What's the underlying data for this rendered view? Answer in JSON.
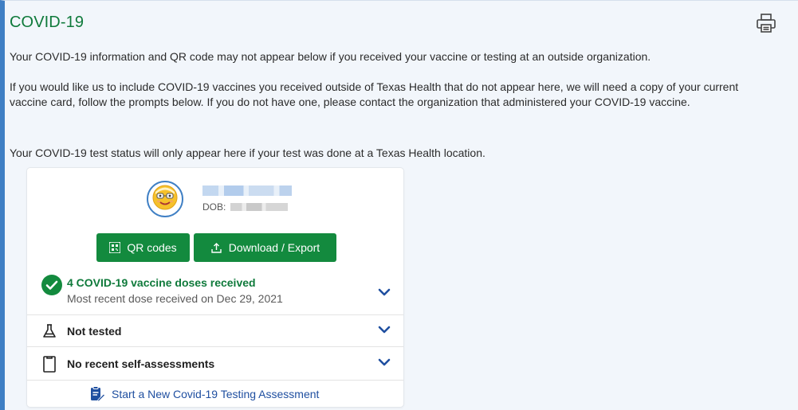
{
  "header": {
    "title": "COVID-19",
    "print_icon": "printer-icon"
  },
  "info": {
    "p1": "Your COVID-19 information and QR code may not appear below if you received your vaccine or testing at an outside organization.",
    "p2": "If you would like us to include COVID-19 vaccines you received outside of Texas Health that do not appear here, we will need a copy of your current vaccine card, follow the prompts below. If you do not have one, please contact the organization that administered your COVID-19 vaccine.",
    "p3": "Your COVID-19 test status will only appear here if your test was done at a Texas Health location."
  },
  "patient": {
    "avatar_icon": "emoji-avatar-icon",
    "dob_label": "DOB:"
  },
  "buttons": {
    "qr_label": "QR codes",
    "download_label": "Download / Export"
  },
  "status": {
    "vaccine_title": "4 COVID-19 vaccine doses received",
    "vaccine_sub": "Most recent dose received on Dec 29, 2021",
    "test_title": "Not tested",
    "self_title": "No recent self-assessments"
  },
  "actions": {
    "start_label": "Start a New Covid-19 Testing Assessment"
  },
  "colors": {
    "brand_green": "#138a3e",
    "title_green": "#0f7a3b",
    "accent_blue": "#3f7fc4",
    "link_blue": "#1f4fa0",
    "chevron_blue": "#1f4fa0"
  }
}
